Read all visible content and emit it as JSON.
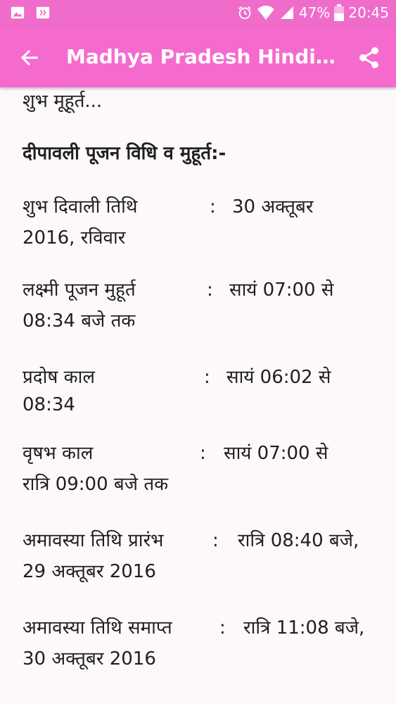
{
  "status_bar": {
    "battery": "47%",
    "time": "20:45",
    "icons": [
      "image-icon",
      "app-icon",
      "alarm-icon",
      "wifi-icon",
      "signal-icon",
      "battery-icon"
    ]
  },
  "app_bar": {
    "title": "Madhya Pradesh Hindi Ne...",
    "back_icon": "back-arrow-icon",
    "share_icon": "share-icon"
  },
  "article": {
    "intro_tail": "शुभ मूहूर्त...",
    "heading": "दीपावली पूजन विधि व मुहूर्त:-",
    "rows": [
      {
        "label": "शुभ दिवाली तिथि",
        "colon": ":",
        "value_line1": "30 अक्तूबर",
        "value_line2": "2016, रविवार"
      },
      {
        "label": "लक्ष्मी पूजन मुहूर्त",
        "colon": ":",
        "value_line1": "सायं 07:00 से",
        "value_line2": "08:34 बजे तक"
      },
      {
        "label": "प्रदोष काल",
        "colon": ":",
        "value_line1": "सायं 06:02 से",
        "value_line2": "08:34"
      },
      {
        "label": "वृषभ काल",
        "colon": ":",
        "value_line1": "सायं 07:00 से",
        "value_line2": "रात्रि 09:00 बजे तक"
      },
      {
        "label": "अमावस्या तिथि प्रारंभ",
        "colon": ":",
        "value_line1": "रात्रि 08:40 बजे,",
        "value_line2": "29 अक्तूबर 2016"
      },
      {
        "label": "अमावस्या तिथि समाप्त",
        "colon": ":",
        "value_line1": "रात्रि 11:08 बजे,",
        "value_line2": "30 अक्तूबर 2016"
      }
    ]
  },
  "colors": {
    "status_bar": "#f06ccb",
    "app_bar": "#f56bcd",
    "background": "#fcf8fc",
    "text": "#1f1f1f"
  }
}
